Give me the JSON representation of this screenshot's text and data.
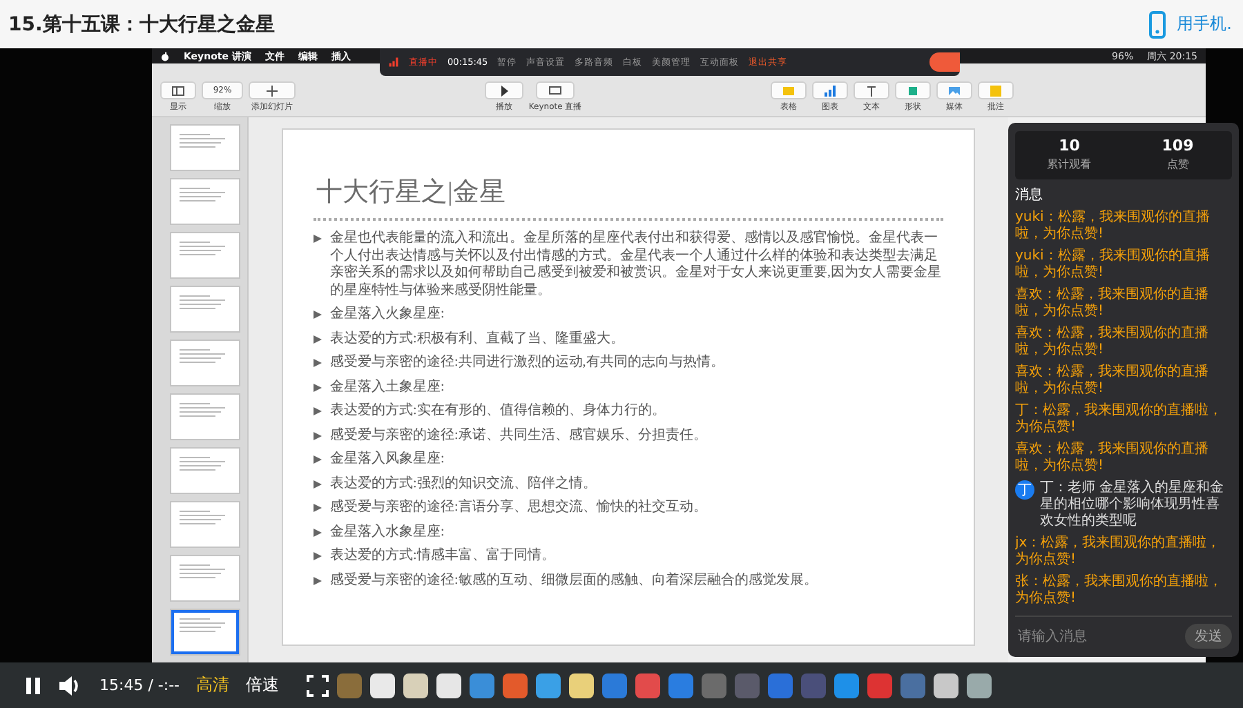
{
  "page_title": "15.第十五课：十大行星之金星",
  "mobile_link": "用手机.",
  "mac_menu": [
    "Keynote 讲演",
    "文件",
    "编辑",
    "插入"
  ],
  "mac_status": {
    "battery": "96%",
    "clock": "周六 20:15"
  },
  "live_bar": {
    "status": "直播中",
    "time": "00:15:45",
    "items": [
      "暂停",
      "声音设置",
      "多路音频",
      "白板",
      "美颜管理",
      "互动面板"
    ],
    "exit": "退出共享"
  },
  "toolbar": {
    "left": [
      {
        "label": "显示"
      },
      {
        "label": "缩放",
        "value": "92%"
      },
      {
        "label": "添加幻灯片"
      }
    ],
    "center": [
      {
        "label": "播放"
      },
      {
        "label": "Keynote 直播"
      }
    ],
    "right": [
      {
        "label": "表格"
      },
      {
        "label": "图表"
      },
      {
        "label": "文本"
      },
      {
        "label": "形状"
      },
      {
        "label": "媒体"
      },
      {
        "label": "批注"
      }
    ]
  },
  "thumbnails": [
    {
      "selected": false
    },
    {
      "selected": false
    },
    {
      "selected": false
    },
    {
      "selected": false
    },
    {
      "selected": false
    },
    {
      "selected": false
    },
    {
      "selected": false
    },
    {
      "selected": false
    },
    {
      "selected": false
    },
    {
      "selected": true
    }
  ],
  "slide": {
    "title": "十大行星之|金星",
    "bullets": [
      "金星也代表能量的流入和流出。金星所落的星座代表付出和获得爱、感情以及感官愉悦。金星代表一个人付出表达情感与关怀以及付出情感的方式。金星代表一个人通过什么样的体验和表达类型去满足亲密关系的需求以及如何帮助自己感受到被爱和被赏识。金星对于女人来说更重要,因为女人需要金星的星座特性与体验来感受阴性能量。",
      "金星落入火象星座:",
      "表达爱的方式:积极有利、直截了当、隆重盛大。",
      "感受爱与亲密的途径:共同进行激烈的运动,有共同的志向与热情。",
      "金星落入土象星座:",
      "表达爱的方式:实在有形的、值得信赖的、身体力行的。",
      "感受爱与亲密的途径:承诺、共同生活、感官娱乐、分担责任。",
      "金星落入风象星座:",
      "表达爱的方式:强烈的知识交流、陪伴之情。",
      "感受爱与亲密的途径:言语分享、思想交流、愉快的社交互动。",
      "金星落入水象星座:",
      "表达爱的方式:情感丰富、富于同情。",
      "感受爱与亲密的途径:敏感的互动、细微层面的感触、向着深层融合的感觉发展。"
    ]
  },
  "chat": {
    "stats": [
      {
        "value": "10",
        "label": "累计观看"
      },
      {
        "value": "109",
        "label": "点赞"
      }
    ],
    "heading": "消息",
    "messages": [
      {
        "kind": "notice",
        "text": "yuki：松露，我来围观你的直播啦，为你点赞!"
      },
      {
        "kind": "notice",
        "text": "yuki：松露，我来围观你的直播啦，为你点赞!"
      },
      {
        "kind": "notice",
        "text": "喜欢：松露，我来围观你的直播啦，为你点赞!"
      },
      {
        "kind": "notice",
        "text": "喜欢：松露，我来围观你的直播啦，为你点赞!"
      },
      {
        "kind": "notice",
        "text": "喜欢：松露，我来围观你的直播啦，为你点赞!"
      },
      {
        "kind": "notice",
        "text": "丁：松露，我来围观你的直播啦，为你点赞!"
      },
      {
        "kind": "notice",
        "text": "喜欢：松露，我来围观你的直播啦，为你点赞!"
      },
      {
        "kind": "question",
        "avatar": "丁",
        "text": "丁：老师 金星落入的星座和金星的相位哪个影响体现男性喜欢女性的类型呢"
      },
      {
        "kind": "notice",
        "text": "jx：松露，我来围观你的直播啦，为你点赞!"
      },
      {
        "kind": "notice",
        "text": "张：松露，我来围观你的直播啦，为你点赞!"
      }
    ],
    "placeholder": "请输入消息",
    "send": "发送"
  },
  "player": {
    "time": "15:45 / -:--",
    "quality": "高清",
    "speed": "倍速"
  }
}
